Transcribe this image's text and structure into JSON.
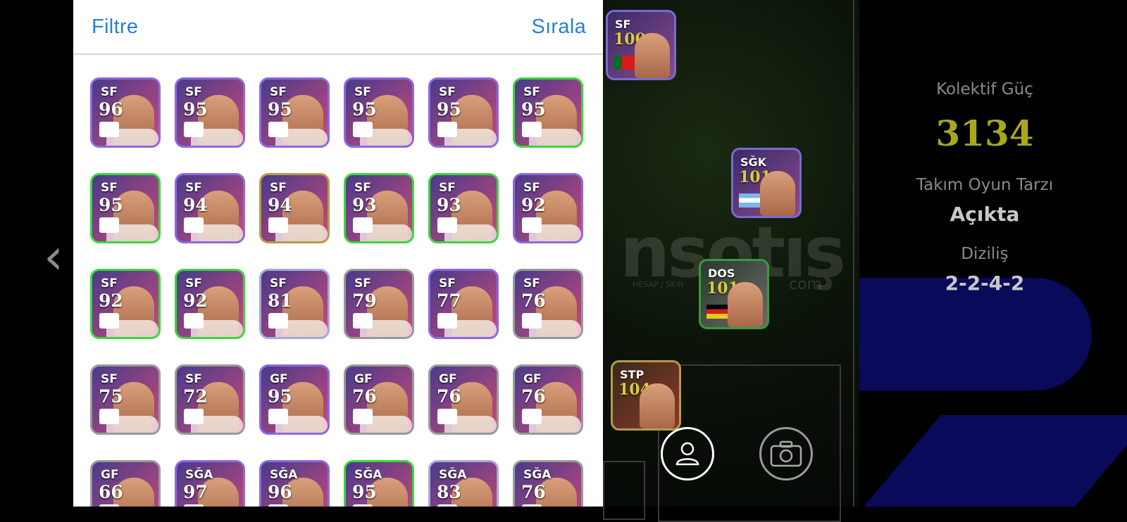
{
  "header": {
    "filter_label": "Filtre",
    "sort_label": "Sırala"
  },
  "nav": {
    "back_icon": "chevron-left-icon"
  },
  "players": [
    {
      "pos": "SF",
      "rating": "96",
      "color": "#8a6ae0"
    },
    {
      "pos": "SF",
      "rating": "95",
      "color": "#8a6ae0"
    },
    {
      "pos": "SF",
      "rating": "95",
      "color": "#8a6ae0"
    },
    {
      "pos": "SF",
      "rating": "95",
      "color": "#8a6ae0"
    },
    {
      "pos": "SF",
      "rating": "95",
      "color": "#8a6ae0"
    },
    {
      "pos": "SF",
      "rating": "95",
      "color": "#3ad83a"
    },
    {
      "pos": "SF",
      "rating": "95",
      "color": "#3ad83a"
    },
    {
      "pos": "SF",
      "rating": "94",
      "color": "#8a6ae0"
    },
    {
      "pos": "SF",
      "rating": "94",
      "color": "#b89a4a"
    },
    {
      "pos": "SF",
      "rating": "93",
      "color": "#3ad83a"
    },
    {
      "pos": "SF",
      "rating": "93",
      "color": "#3ad83a"
    },
    {
      "pos": "SF",
      "rating": "92",
      "color": "#8a6ae0"
    },
    {
      "pos": "SF",
      "rating": "92",
      "color": "#3ad83a"
    },
    {
      "pos": "SF",
      "rating": "92",
      "color": "#3ad83a"
    },
    {
      "pos": "SF",
      "rating": "81",
      "color": "#a8a8d8"
    },
    {
      "pos": "SF",
      "rating": "79",
      "color": "#9a9a9a"
    },
    {
      "pos": "SF",
      "rating": "77",
      "color": "#8a6ae0"
    },
    {
      "pos": "SF",
      "rating": "76",
      "color": "#9a9a9a"
    },
    {
      "pos": "SF",
      "rating": "75",
      "color": "#9a9a9a"
    },
    {
      "pos": "SF",
      "rating": "72",
      "color": "#9a9a9a"
    },
    {
      "pos": "GF",
      "rating": "95",
      "color": "#8a6ae0"
    },
    {
      "pos": "GF",
      "rating": "76",
      "color": "#9a9a9a"
    },
    {
      "pos": "GF",
      "rating": "76",
      "color": "#9a9a9a"
    },
    {
      "pos": "GF",
      "rating": "76",
      "color": "#9a9a9a"
    },
    {
      "pos": "GF",
      "rating": "66",
      "color": "#9a9a9a"
    },
    {
      "pos": "SĞA",
      "rating": "97",
      "color": "#8a6ae0"
    },
    {
      "pos": "SĞA",
      "rating": "96",
      "color": "#8a6ae0"
    },
    {
      "pos": "SĞA",
      "rating": "95",
      "color": "#3ad83a"
    },
    {
      "pos": "SĞA",
      "rating": "83",
      "color": "#a8a8d8"
    },
    {
      "pos": "SĞA",
      "rating": "76",
      "color": "#9a9a9a"
    }
  ],
  "field_players": [
    {
      "pos": "SF",
      "rating": "100"
    },
    {
      "pos": "SĞK",
      "rating": "101"
    },
    {
      "pos": "DOS",
      "rating": "101"
    },
    {
      "pos": "STP",
      "rating": "104"
    }
  ],
  "team": {
    "power_label": "Kolektif Güç",
    "power_value": "3134",
    "style_label": "Takım Oyun Tarzı",
    "style_value": "Açıkta",
    "formation_label": "Diziliş",
    "formation_value": "2-2-4-2"
  },
  "watermark": {
    "main": "nsotış",
    "sub": "HESAP / SKIN",
    "com": "com"
  },
  "buttons": {
    "profile_icon": "user-icon",
    "camera_icon": "camera-icon"
  }
}
